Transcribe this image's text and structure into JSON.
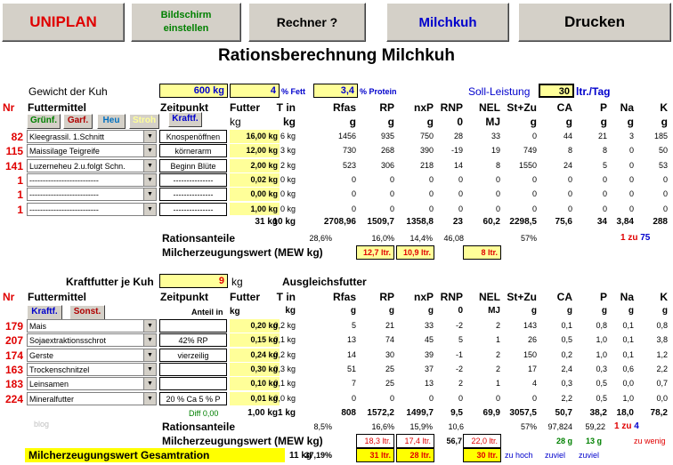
{
  "toolbar": {
    "uniplan": "UNIPLAN",
    "bildschirm_1": "Bildschirm",
    "bildschirm_2": "einstellen",
    "rechner": "Rechner ?",
    "milchkuh": "Milchkuh",
    "drucken": "Drucken"
  },
  "title": "Rationsberechnung Milchkuh",
  "gewicht": {
    "label": "Gewicht der Kuh",
    "value": "600 kg",
    "fett_value": "4",
    "fett_label": "% Fett",
    "protein_value": "3,4",
    "protein_label": "% Protein",
    "soll_label": "Soll-Leistung",
    "soll_value": "30",
    "soll_unit": "ltr./Tag"
  },
  "headers": {
    "nr": "Nr",
    "futtermittel": "Futtermittel",
    "zeitpunkt": "Zeitpunkt",
    "futter": "Futter",
    "tin": "T in",
    "rfas": "Rfas",
    "rp": "RP",
    "nxp": "nxP",
    "rnp": "RNP",
    "nel": "NEL",
    "stzu": "St+Zu",
    "ca": "CA",
    "p": "P",
    "na": "Na",
    "k": "K"
  },
  "units1": {
    "futter": "kg",
    "tin": "kg",
    "rfas": "g",
    "rp": "g",
    "nxp": "g",
    "rnp": "0",
    "nel": "MJ",
    "stzu": "g",
    "ca": "g",
    "p": "g",
    "na": "g",
    "k": "g"
  },
  "tabs1": [
    "Grünf.",
    "Garf.",
    "Heu",
    "Stroh",
    "Kraftf."
  ],
  "rows1": [
    {
      "nr": "82",
      "name": "Kleegrassil. 1.Schnitt",
      "zp": "Knospenöffnen",
      "futter": "16,00 kg",
      "tin": "6 kg",
      "rfas": "1456",
      "rp": "935",
      "nxp": "750",
      "rnp": "28",
      "nel": "33",
      "stzu": "0",
      "ca": "44",
      "p": "21",
      "na": "3",
      "k": "185"
    },
    {
      "nr": "115",
      "name": "Maissilage Teigreife",
      "zp": "körnerarm",
      "futter": "12,00 kg",
      "tin": "3 kg",
      "rfas": "730",
      "rp": "268",
      "nxp": "390",
      "rnp": "-19",
      "nel": "19",
      "stzu": "749",
      "ca": "8",
      "p": "8",
      "na": "0",
      "k": "50"
    },
    {
      "nr": "141",
      "name": "Luzerneheu 2.u.folgt Schn.",
      "zp": "Beginn Blüte",
      "futter": "2,00 kg",
      "tin": "2 kg",
      "rfas": "523",
      "rp": "306",
      "nxp": "218",
      "rnp": "14",
      "nel": "8",
      "stzu": "1550",
      "ca": "24",
      "p": "5",
      "na": "0",
      "k": "53"
    },
    {
      "nr": "1",
      "name": "--------------------------",
      "zp": "---------------",
      "futter": "0,02 kg",
      "tin": "0 kg",
      "rfas": "0",
      "rp": "0",
      "nxp": "0",
      "rnp": "0",
      "nel": "0",
      "stzu": "0",
      "ca": "0",
      "p": "0",
      "na": "0",
      "k": "0"
    },
    {
      "nr": "1",
      "name": "--------------------------",
      "zp": "---------------",
      "futter": "0,00 kg",
      "tin": "0 kg",
      "rfas": "0",
      "rp": "0",
      "nxp": "0",
      "rnp": "0",
      "nel": "0",
      "stzu": "0",
      "ca": "0",
      "p": "0",
      "na": "0",
      "k": "0"
    },
    {
      "nr": "1",
      "name": "--------------------------",
      "zp": "---------------",
      "futter": "1,00 kg",
      "tin": "0 kg",
      "rfas": "0",
      "rp": "0",
      "nxp": "0",
      "rnp": "0",
      "nel": "0",
      "stzu": "0",
      "ca": "0",
      "p": "0",
      "na": "0",
      "k": "0"
    }
  ],
  "sum1": {
    "futter": "31 kg",
    "tin": "10 kg",
    "rfas": "2708,96",
    "rp": "1509,7",
    "nxp": "1358,8",
    "rnp": "23",
    "nel": "60,2",
    "stzu": "2298,5",
    "ca": "75,6",
    "p": "34",
    "na": "3,84",
    "k": "288"
  },
  "ration1": {
    "label": "Rationsanteile",
    "rfas": "28,6%",
    "rp": "16,0%",
    "nxp": "14,4%",
    "rnp": "46,08",
    "stzu": "57%",
    "ratio_a": "1",
    "ratio_zu": "zu",
    "ratio_b": "75"
  },
  "mew1": {
    "label": "Milcherzeugungswert (MEW kg)",
    "v1": "12,7 ltr.",
    "v2": "10,9 ltr.",
    "v3": "8 ltr."
  },
  "kraft": {
    "label": "Kraftfutter je Kuh",
    "value": "9",
    "unit": "kg",
    "ausgleich": "Ausgleichsfutter"
  },
  "units2": {
    "zp": "Anteil in",
    "futter": "kg",
    "tin": "kg",
    "rfas": "g",
    "rp": "g",
    "nxp": "g",
    "rnp": "0",
    "nel": "MJ",
    "stzu": "g",
    "ca": "g",
    "p": "g",
    "na": "g",
    "k": "g"
  },
  "tabs2": [
    "Kraftf.",
    "Sonst."
  ],
  "rows2": [
    {
      "nr": "179",
      "name": "Mais",
      "zp": "",
      "futter": "0,20 kg",
      "tin": "0,2 kg",
      "rfas": "5",
      "rp": "21",
      "nxp": "33",
      "rnp": "-2",
      "nel": "2",
      "stzu": "143",
      "ca": "0,1",
      "p": "0,8",
      "na": "0,1",
      "k": "0,8"
    },
    {
      "nr": "207",
      "name": "Sojaextraktionsschrot",
      "zp": "42% RP",
      "futter": "0,15 kg",
      "tin": "0,1 kg",
      "rfas": "13",
      "rp": "74",
      "nxp": "45",
      "rnp": "5",
      "nel": "1",
      "stzu": "26",
      "ca": "0,5",
      "p": "1,0",
      "na": "0,1",
      "k": "3,8"
    },
    {
      "nr": "174",
      "name": "Gerste",
      "zp": "vierzeilig",
      "futter": "0,24 kg",
      "tin": "0,2 kg",
      "rfas": "14",
      "rp": "30",
      "nxp": "39",
      "rnp": "-1",
      "nel": "2",
      "stzu": "150",
      "ca": "0,2",
      "p": "1,0",
      "na": "0,1",
      "k": "1,2"
    },
    {
      "nr": "163",
      "name": "Trockenschnitzel",
      "zp": "",
      "futter": "0,30 kg",
      "tin": "0,3 kg",
      "rfas": "51",
      "rp": "25",
      "nxp": "37",
      "rnp": "-2",
      "nel": "2",
      "stzu": "17",
      "ca": "2,4",
      "p": "0,3",
      "na": "0,6",
      "k": "2,2"
    },
    {
      "nr": "183",
      "name": "Leinsamen",
      "zp": "",
      "futter": "0,10 kg",
      "tin": "0,1 kg",
      "rfas": "7",
      "rp": "25",
      "nxp": "13",
      "rnp": "2",
      "nel": "1",
      "stzu": "4",
      "ca": "0,3",
      "p": "0,5",
      "na": "0,0",
      "k": "0,7"
    },
    {
      "nr": "224",
      "name": "Mineralfutter",
      "zp": "20 % Ca 5 % P",
      "futter": "0,01 kg",
      "tin": "0,0 kg",
      "rfas": "0",
      "rp": "0",
      "nxp": "0",
      "rnp": "0",
      "nel": "0",
      "stzu": "0",
      "ca": "2,2",
      "p": "0,5",
      "na": "1,0",
      "k": "0,0"
    }
  ],
  "sum2": {
    "diff": "Diff 0,00",
    "futter": "1,00 kg",
    "tin": "1 kg",
    "rfas": "808",
    "rp": "1572,2",
    "nxp": "1499,7",
    "rnp": "9,5",
    "nel": "69,9",
    "stzu": "3057,5",
    "ca": "50,7",
    "p": "38,2",
    "na": "18,0",
    "k": "78,2"
  },
  "ration2": {
    "blog": "blog",
    "label": "Rationsanteile",
    "rfas": "8,5%",
    "rp": "16,6%",
    "nxp": "15,9%",
    "rnp": "10,6",
    "stzu": "57%",
    "ca": "97,824",
    "p": "59,22",
    "ratio_a": "1",
    "ratio_zu": "zu",
    "ratio_b": "4"
  },
  "mew2": {
    "label": "Milcherzeugungswert (MEW kg)",
    "v1": "18,3 ltr.",
    "v2": "17,4 ltr.",
    "rnp": "56,7",
    "v3": "22,0 ltr.",
    "ca": "28 g",
    "p": "13 g",
    "warn": "zu wenig"
  },
  "gesamt": {
    "label": "Milcherzeugungswert Gesamtration",
    "tin": "11 kg",
    "rfas": "37,19%",
    "v1": "31 ltr.",
    "v2": "28 ltr.",
    "v3": "30 ltr.",
    "zuhoch": "zu hoch",
    "zuviel1": "zuviel",
    "zuviel2": "zuviel"
  }
}
